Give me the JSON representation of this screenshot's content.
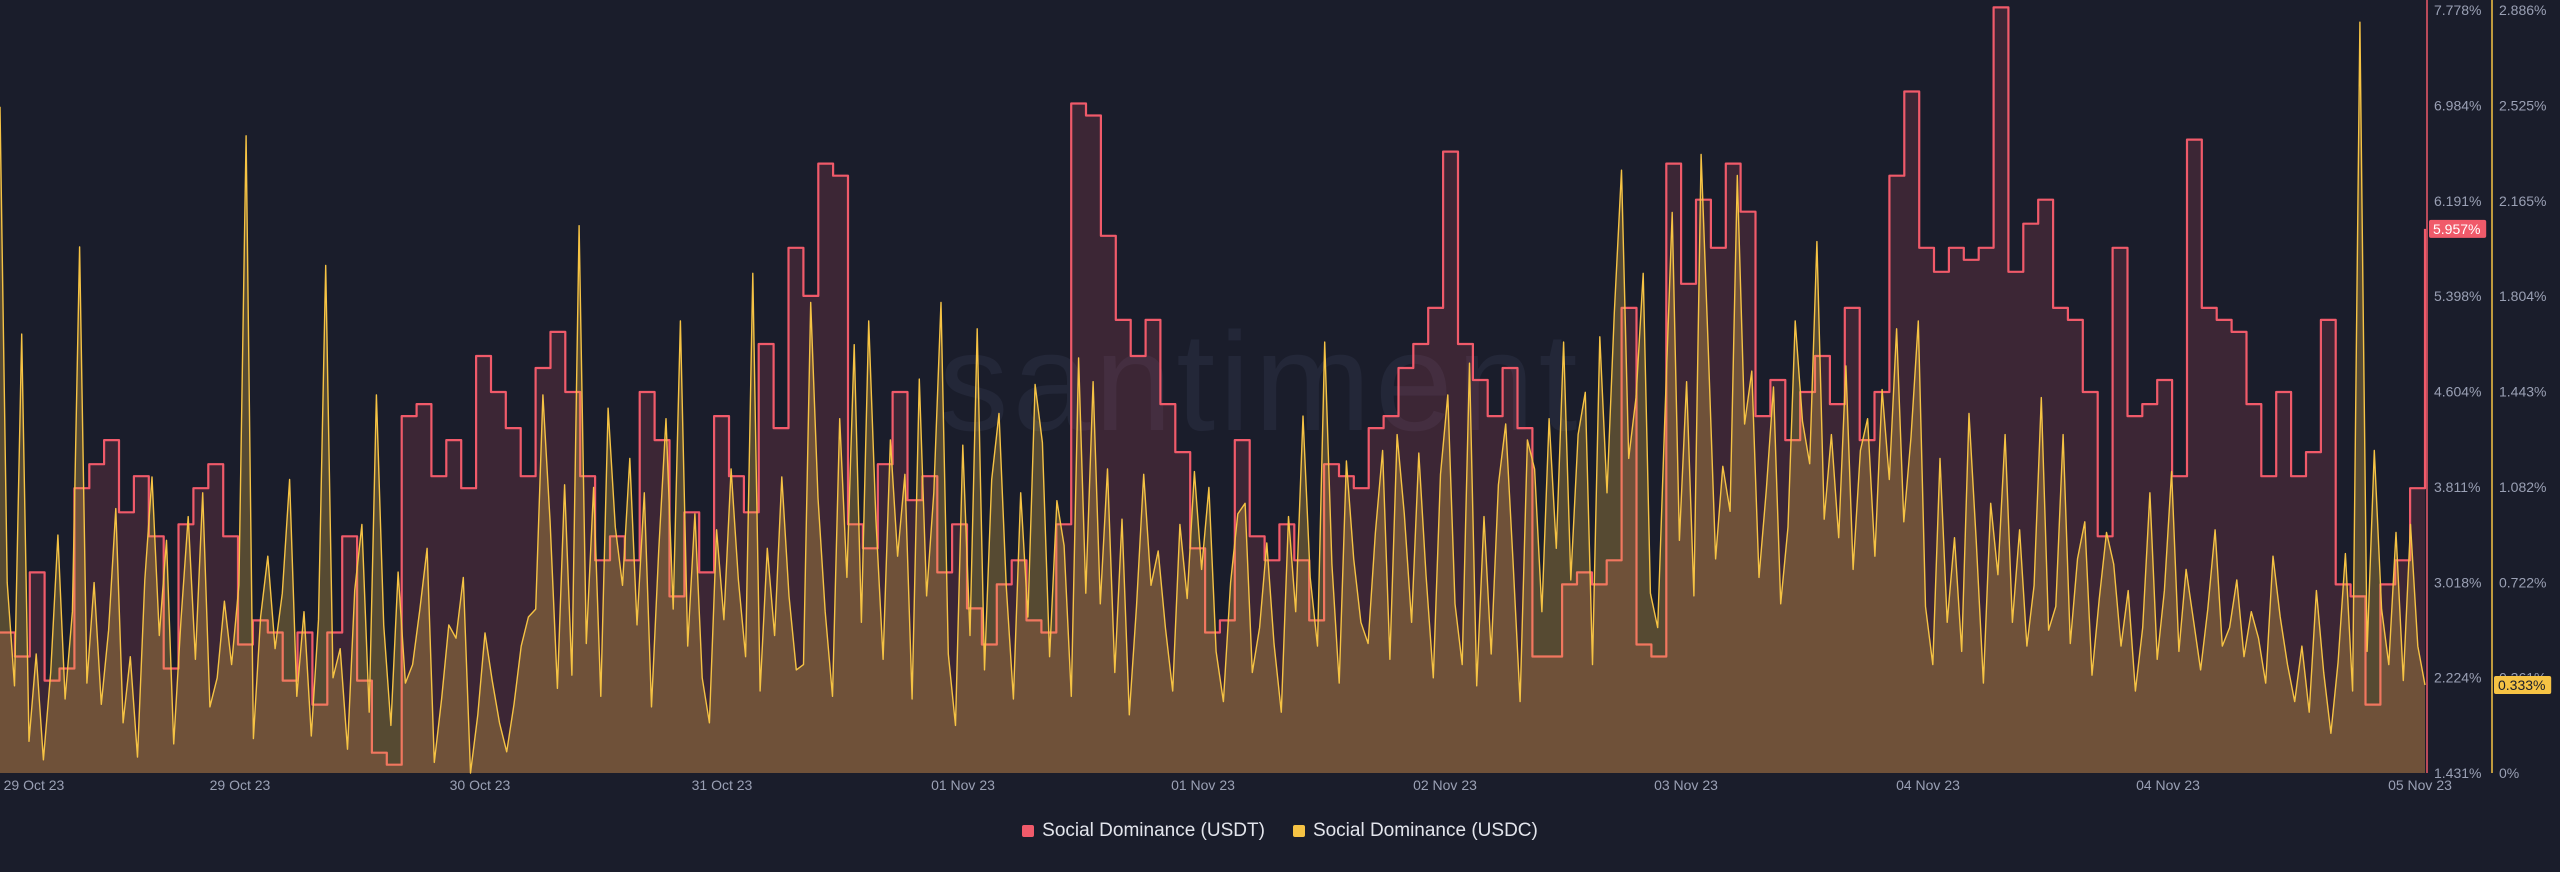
{
  "watermark": "santiment",
  "colors": {
    "background": "#1a1d2b",
    "usdt": "#f05a6a",
    "usdc": "#f6c344",
    "axis_text": "#9aa0b4",
    "grid": "#242838"
  },
  "chart_data": {
    "type": "line",
    "x_tick_labels": [
      "29 Oct 23",
      "29 Oct 23",
      "30 Oct 23",
      "31 Oct 23",
      "01 Nov 23",
      "01 Nov 23",
      "02 Nov 23",
      "03 Nov 23",
      "04 Nov 23",
      "04 Nov 23",
      "05 Nov 23"
    ],
    "y_left_ticks": [
      "7.778%",
      "6.984%",
      "6.191%",
      "5.398%",
      "4.604%",
      "3.811%",
      "3.018%",
      "2.224%",
      "1.431%"
    ],
    "y_right_ticks": [
      "2.886%",
      "2.525%",
      "2.165%",
      "1.804%",
      "1.443%",
      "1.082%",
      "0.722%",
      "0.361%",
      "0%"
    ],
    "usdt_axis": {
      "min": 1.431,
      "max": 7.778,
      "unit": "%"
    },
    "usdc_axis": {
      "min": 0,
      "max": 2.886,
      "unit": "%"
    },
    "last_value_badges": {
      "usdt": "5.957%",
      "usdc": "0.333%"
    },
    "series": [
      {
        "name": "Social Dominance (USDT)",
        "color": "#f05a6a",
        "area": true,
        "values": [
          2.6,
          2.6,
          2.4,
          2.4,
          3.1,
          3.1,
          2.2,
          2.2,
          2.3,
          2.3,
          3.8,
          3.8,
          4.0,
          4.0,
          4.2,
          4.2,
          3.6,
          3.6,
          3.9,
          3.9,
          3.4,
          3.4,
          2.3,
          2.3,
          3.5,
          3.5,
          3.8,
          3.8,
          4.0,
          4.0,
          3.4,
          3.4,
          2.5,
          2.5,
          2.7,
          2.7,
          2.6,
          2.6,
          2.2,
          2.2,
          2.6,
          2.6,
          2.0,
          2.0,
          2.6,
          2.6,
          3.4,
          3.4,
          2.2,
          2.2,
          1.6,
          1.6,
          1.5,
          1.5,
          4.4,
          4.4,
          4.5,
          4.5,
          3.9,
          3.9,
          4.2,
          4.2,
          3.8,
          3.8,
          4.9,
          4.9,
          4.6,
          4.6,
          4.3,
          4.3,
          3.9,
          3.9,
          4.8,
          4.8,
          5.1,
          5.1,
          4.6,
          4.6,
          3.9,
          3.9,
          3.2,
          3.2,
          3.4,
          3.4,
          3.2,
          3.2,
          4.6,
          4.6,
          4.2,
          4.2,
          2.9,
          2.9,
          3.6,
          3.6,
          3.1,
          3.1,
          4.4,
          4.4,
          3.9,
          3.9,
          3.6,
          3.6,
          5.0,
          5.0,
          4.3,
          4.3,
          5.8,
          5.8,
          5.4,
          5.4,
          6.5,
          6.5,
          6.4,
          6.4,
          3.5,
          3.5,
          3.3,
          3.3,
          4.0,
          4.0,
          4.6,
          4.6,
          3.7,
          3.7,
          3.9,
          3.9,
          3.1,
          3.1,
          3.5,
          3.5,
          2.8,
          2.8,
          2.5,
          2.5,
          3.0,
          3.0,
          3.2,
          3.2,
          2.7,
          2.7,
          2.6,
          2.6,
          3.5,
          3.5,
          7.0,
          7.0,
          6.9,
          6.9,
          5.9,
          5.9,
          5.2,
          5.2,
          4.9,
          4.9,
          5.2,
          5.2,
          4.5,
          4.5,
          4.1,
          4.1,
          3.3,
          3.3,
          2.6,
          2.6,
          2.7,
          2.7,
          4.2,
          4.2,
          3.4,
          3.4,
          3.2,
          3.2,
          3.5,
          3.5,
          3.2,
          3.2,
          2.7,
          2.7,
          4.0,
          4.0,
          3.9,
          3.9,
          3.8,
          3.8,
          4.3,
          4.3,
          4.4,
          4.4,
          4.8,
          4.8,
          5.0,
          5.0,
          5.3,
          5.3,
          6.6,
          6.6,
          5.0,
          5.0,
          4.7,
          4.7,
          4.4,
          4.4,
          4.8,
          4.8,
          4.3,
          4.3,
          2.4,
          2.4,
          2.4,
          2.4,
          3.0,
          3.0,
          3.1,
          3.1,
          3.0,
          3.0,
          3.2,
          3.2,
          5.3,
          5.3,
          2.5,
          2.5,
          2.4,
          2.4,
          6.5,
          6.5,
          5.5,
          5.5,
          6.2,
          6.2,
          5.8,
          5.8,
          6.5,
          6.5,
          6.1,
          6.1,
          4.4,
          4.4,
          4.7,
          4.7,
          4.2,
          4.2,
          4.6,
          4.6,
          4.9,
          4.9,
          4.5,
          4.5,
          5.3,
          5.3,
          4.2,
          4.2,
          4.6,
          4.6,
          6.4,
          6.4,
          7.1,
          7.1,
          5.8,
          5.8,
          5.6,
          5.6,
          5.8,
          5.8,
          5.7,
          5.7,
          5.8,
          5.8,
          7.8,
          7.8,
          5.6,
          5.6,
          6.0,
          6.0,
          6.2,
          6.2,
          5.3,
          5.3,
          5.2,
          5.2,
          4.6,
          4.6,
          3.4,
          3.4,
          5.8,
          5.8,
          4.4,
          4.4,
          4.5,
          4.5,
          4.7,
          4.7,
          3.9,
          3.9,
          6.7,
          6.7,
          5.3,
          5.3,
          5.2,
          5.2,
          5.1,
          5.1,
          4.5,
          4.5,
          3.9,
          3.9,
          4.6,
          4.6,
          3.9,
          3.9,
          4.1,
          4.1,
          5.2,
          5.2,
          3.0,
          3.0,
          2.9,
          2.9,
          2.0,
          2.0,
          3.0,
          3.0,
          3.2,
          3.2,
          3.8,
          3.8,
          5.957
        ]
      },
      {
        "name": "Social Dominance (USDC)",
        "color": "#f6c344",
        "area": true,
        "values": [
          2.52,
          0.72,
          0.33,
          1.66,
          0.12,
          0.45,
          0.05,
          0.38,
          0.9,
          0.28,
          0.61,
          1.99,
          0.34,
          0.72,
          0.26,
          0.54,
          1.0,
          0.19,
          0.44,
          0.06,
          0.73,
          1.12,
          0.52,
          0.88,
          0.11,
          0.58,
          0.97,
          0.43,
          1.06,
          0.25,
          0.36,
          0.65,
          0.41,
          0.71,
          2.41,
          0.13,
          0.59,
          0.82,
          0.47,
          0.68,
          1.11,
          0.29,
          0.61,
          0.14,
          0.58,
          1.92,
          0.36,
          0.47,
          0.09,
          0.69,
          0.94,
          0.23,
          1.43,
          0.56,
          0.18,
          0.76,
          0.34,
          0.41,
          0.62,
          0.85,
          0.04,
          0.28,
          0.56,
          0.51,
          0.74,
          0.0,
          0.22,
          0.53,
          0.35,
          0.19,
          0.08,
          0.26,
          0.48,
          0.59,
          0.62,
          1.43,
          0.95,
          0.32,
          1.09,
          0.37,
          2.07,
          0.49,
          1.08,
          0.29,
          1.38,
          0.93,
          0.71,
          1.19,
          0.56,
          1.06,
          0.25,
          0.84,
          1.34,
          0.62,
          1.71,
          0.48,
          0.98,
          0.36,
          0.19,
          0.92,
          0.58,
          1.15,
          0.73,
          0.44,
          1.89,
          0.31,
          0.85,
          0.52,
          1.12,
          0.67,
          0.39,
          0.41,
          1.78,
          1.04,
          0.61,
          0.29,
          1.34,
          0.74,
          1.62,
          0.57,
          1.71,
          0.96,
          0.43,
          1.26,
          0.82,
          1.13,
          0.28,
          1.49,
          0.67,
          1.06,
          1.78,
          0.45,
          0.18,
          1.24,
          0.52,
          1.68,
          0.39,
          1.11,
          1.36,
          0.71,
          0.28,
          1.06,
          0.59,
          1.47,
          1.25,
          0.44,
          1.03,
          0.86,
          0.29,
          1.57,
          0.68,
          1.48,
          0.64,
          1.15,
          0.38,
          0.96,
          0.22,
          0.63,
          1.13,
          0.71,
          0.84,
          0.55,
          0.31,
          0.94,
          0.66,
          1.14,
          0.77,
          1.08,
          0.46,
          0.27,
          0.72,
          0.98,
          1.02,
          0.38,
          0.55,
          0.87,
          0.49,
          0.23,
          0.97,
          0.61,
          1.35,
          0.74,
          0.48,
          1.63,
          0.79,
          0.34,
          1.18,
          0.81,
          0.57,
          0.49,
          0.91,
          1.22,
          0.43,
          1.28,
          0.98,
          0.57,
          1.21,
          0.75,
          0.36,
          1.13,
          1.43,
          0.64,
          0.41,
          1.55,
          0.33,
          0.97,
          0.45,
          1.09,
          1.32,
          0.81,
          0.27,
          1.26,
          1.15,
          0.61,
          1.34,
          0.85,
          1.63,
          0.73,
          1.28,
          1.44,
          0.41,
          1.65,
          1.06,
          1.74,
          2.28,
          1.19,
          1.42,
          1.89,
          0.68,
          0.55,
          1.35,
          2.12,
          0.88,
          1.48,
          0.67,
          2.34,
          1.59,
          0.81,
          1.16,
          0.99,
          2.26,
          1.32,
          1.52,
          0.74,
          1.07,
          1.46,
          0.64,
          0.93,
          1.71,
          1.33,
          1.17,
          2.01,
          0.96,
          1.28,
          0.89,
          1.54,
          0.77,
          1.22,
          1.34,
          0.82,
          1.45,
          1.11,
          1.68,
          0.95,
          1.27,
          1.71,
          0.63,
          0.41,
          1.19,
          0.57,
          0.89,
          0.46,
          1.36,
          0.88,
          0.34,
          1.02,
          0.75,
          1.28,
          0.57,
          0.92,
          0.48,
          0.71,
          1.42,
          0.54,
          0.63,
          1.28,
          0.49,
          0.81,
          0.95,
          0.37,
          0.66,
          0.91,
          0.79,
          0.48,
          0.69,
          0.31,
          0.55,
          1.06,
          0.43,
          0.69,
          1.14,
          0.46,
          0.77,
          0.58,
          0.39,
          0.62,
          0.92,
          0.48,
          0.55,
          0.73,
          0.44,
          0.61,
          0.51,
          0.34,
          0.82,
          0.59,
          0.41,
          0.27,
          0.48,
          0.23,
          0.69,
          0.38,
          0.15,
          0.42,
          0.83,
          0.31,
          2.84,
          0.46,
          1.22,
          0.62,
          0.41,
          0.91,
          0.35,
          0.94,
          0.48,
          0.333
        ]
      }
    ],
    "grid": false,
    "legend_position": "bottom-center"
  }
}
